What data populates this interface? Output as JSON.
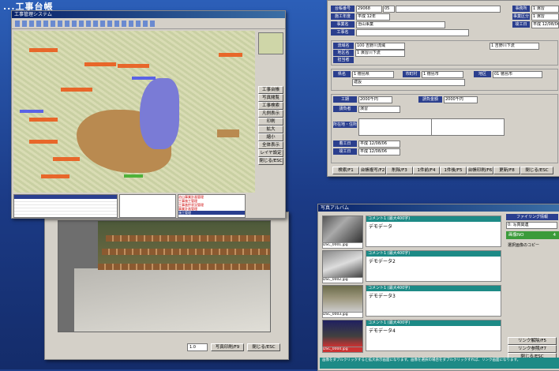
{
  "heading": "...工事台帳",
  "map_window": {
    "title": "工事管理システム",
    "buttons_right": [
      "工事台帳",
      "写真閲覧",
      "工事検索",
      "凡例表示",
      "印刷",
      "拡大",
      "縮小",
      "全体表示",
      "レイヤ設定",
      "閉じる/ESC"
    ],
    "list_items": [
      "治山事業計画管理",
      "工事施工管理",
      "工事進捗状況管理",
      "事業計画管理",
      "施工管理"
    ],
    "zoom_label": "100%"
  },
  "photo_window": {
    "zoom_value": "1.0",
    "print_button": "写真印刷/F9",
    "close_button": "閉じる/ESC"
  },
  "form_window": {
    "labels": {
      "ledger_no": "台帳番号",
      "year": "施工年度",
      "business": "事業名",
      "construction": "工事名",
      "branch": "事務所",
      "type": "事業区分",
      "date": "竣工日",
      "basin": "流域名",
      "area": "地区名",
      "manager": "担当者",
      "pref": "県名",
      "city": "市町村",
      "district": "地区",
      "contractor": "請負者",
      "address": "所在地・住所",
      "period": "工期",
      "amount": "請負金額",
      "start": "着工日",
      "end": "竣工日"
    },
    "values": {
      "ledger_no": "29068",
      "code": "05",
      "year": "平成 12年",
      "business": "治山事業",
      "branch": "1 演習",
      "type": "1 演習",
      "date": "平成 12/08/06",
      "basin": "100 吉野川流域",
      "area": "1 演習川下流",
      "area2": "1 吉野川下流",
      "pref": "1 徳島県",
      "city": "1 徳島市",
      "district": "01 徳島市",
      "contractor": "建設",
      "contractor2": "演習",
      "amount": "2000千円",
      "amount2": "2000千円",
      "start": "平成 12/08/06",
      "end": "平成 12/08/06"
    },
    "bottom_buttons": [
      "検索/F1",
      "台帳複写/F2",
      "削除/F3",
      "1件前/F4",
      "1件後/F5",
      "台帳印刷/F6",
      "更新/F8",
      "閉じる/ESC"
    ]
  },
  "album_window": {
    "title": "写真アルバム",
    "items": [
      {
        "file": "DSC_0001.jpg",
        "header": "コメント1 (最大400字)",
        "text": "デモデータ"
      },
      {
        "file": "DSC_0002.jpg",
        "header": "コメント1 (最大400字)",
        "text": "デモデータ2"
      },
      {
        "file": "DSC_0003.jpg",
        "header": "コメント1 (最大400字)",
        "text": "デモデータ3"
      },
      {
        "file": "DSC_0004.jpg",
        "header": "コメント1 (最大400字)",
        "text": "デモデータ4"
      }
    ],
    "filing_title": "ファイリング情報",
    "category": "0: 写真関連",
    "photo_no": "画像NO",
    "photo_no_value": "4",
    "note": "選択画像のコピー",
    "link_buttons": [
      "リンク解除/F5",
      "リンク参照/F7",
      "閉じる/ESC"
    ],
    "status": "画像をダブルクリックすると拡大表示画面になります。画像を選択の場合をダブルクリックすれば、リンク画面になります。"
  }
}
